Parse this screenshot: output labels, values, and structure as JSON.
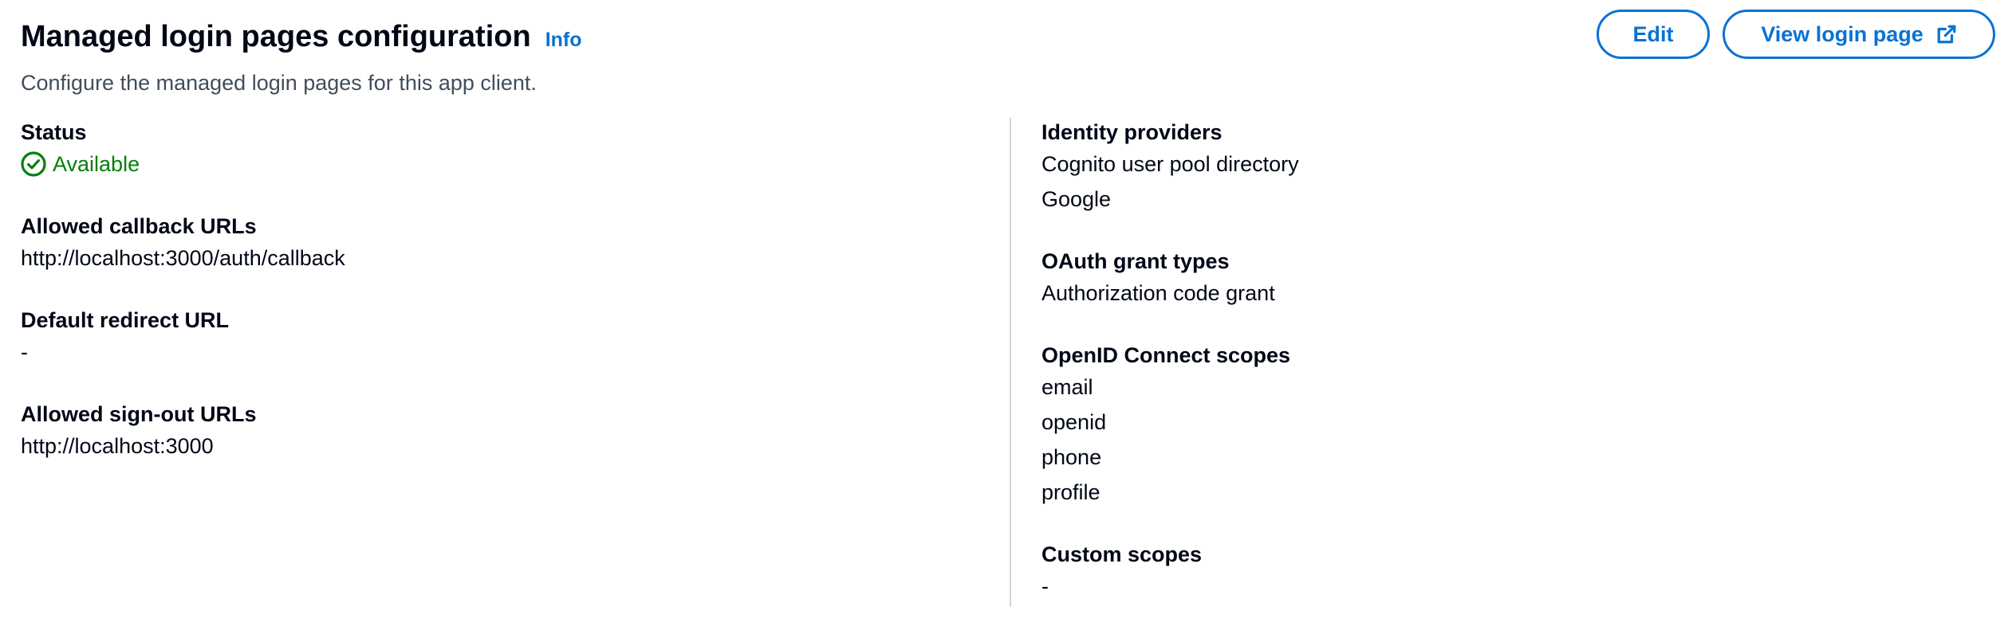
{
  "header": {
    "title": "Managed login pages configuration",
    "info_label": "Info",
    "description": "Configure the managed login pages for this app client.",
    "edit_label": "Edit",
    "view_label": "View login page"
  },
  "left": {
    "status": {
      "label": "Status",
      "value": "Available",
      "color": "#037f0c"
    },
    "callback_urls": {
      "label": "Allowed callback URLs",
      "values": [
        "http://localhost:3000/auth/callback"
      ]
    },
    "default_redirect": {
      "label": "Default redirect URL",
      "value": "-"
    },
    "signout_urls": {
      "label": "Allowed sign-out URLs",
      "values": [
        "http://localhost:3000"
      ]
    }
  },
  "right": {
    "identity_providers": {
      "label": "Identity providers",
      "values": [
        "Cognito user pool directory",
        "Google"
      ]
    },
    "oauth_grant_types": {
      "label": "OAuth grant types",
      "values": [
        "Authorization code grant"
      ]
    },
    "openid_scopes": {
      "label": "OpenID Connect scopes",
      "values": [
        "email",
        "openid",
        "phone",
        "profile"
      ]
    },
    "custom_scopes": {
      "label": "Custom scopes",
      "value": "-"
    }
  },
  "colors": {
    "accent": "#0972d3",
    "text": "#000716",
    "secondary_text": "#414d5c",
    "success": "#037f0c"
  },
  "icons": {
    "status": "check-circle-icon",
    "external": "external-link-icon"
  }
}
